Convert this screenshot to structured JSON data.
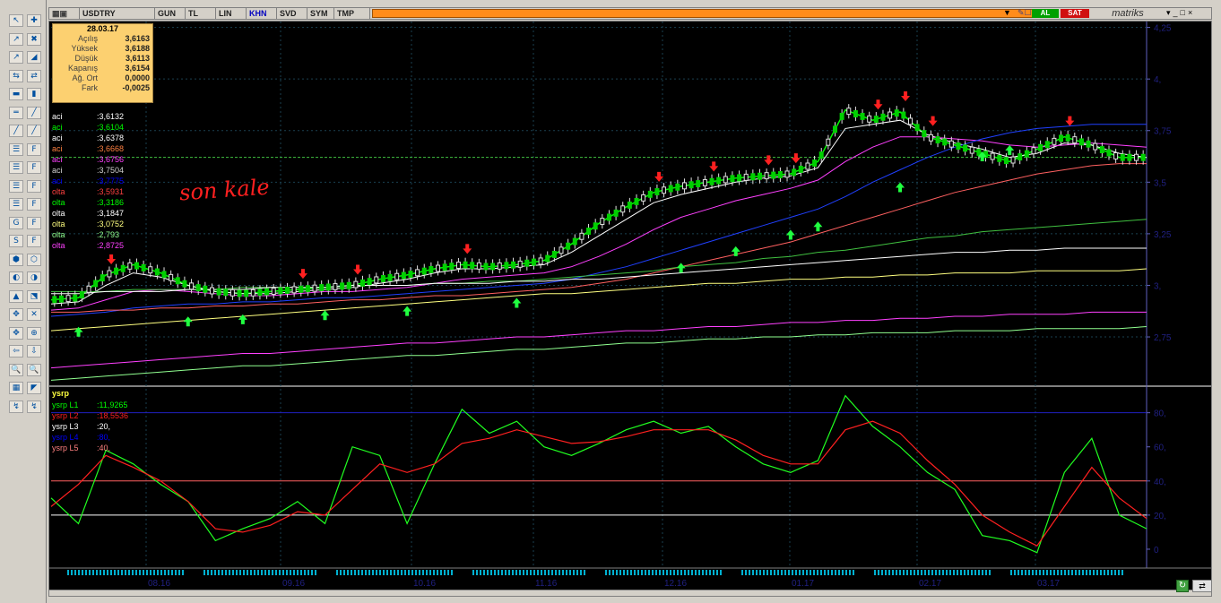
{
  "window": {
    "symbol": "USDTRY",
    "tabs": [
      "GUN",
      "TL",
      "LIN",
      "KHN",
      "SVD",
      "SYM",
      "TMP"
    ],
    "buy_label": "AL",
    "sell_label": "SAT",
    "brand": "matriks"
  },
  "infobox": {
    "date": "28.03.17",
    "rows": [
      {
        "k": "Açılış",
        "v": "3,6163"
      },
      {
        "k": "Yüksek",
        "v": "3,6188"
      },
      {
        "k": "Düşük",
        "v": "3,6113"
      },
      {
        "k": "Kapanış",
        "v": "3,6154"
      },
      {
        "k": "Ağ. Ort",
        "v": "0,0000"
      },
      {
        "k": "Fark",
        "v": "-0,0025"
      }
    ]
  },
  "indicators": [
    {
      "n": "aci",
      "v": ":3,6132",
      "c": "#ffffff"
    },
    {
      "n": "aci",
      "v": ":3,6104",
      "c": "#00ff00"
    },
    {
      "n": "aci",
      "v": ":3,6378",
      "c": "#ffffff"
    },
    {
      "n": "aci",
      "v": ":3,6668",
      "c": "#ff8040"
    },
    {
      "n": "aci",
      "v": ":3,6756",
      "c": "#ff40ff"
    },
    {
      "n": "aci",
      "v": ":3,7504",
      "c": "#d0d0d0"
    },
    {
      "n": "aci",
      "v": ":3,7775",
      "c": "#0000ff"
    },
    {
      "n": "olta",
      "v": ":3,5931",
      "c": "#ff4040"
    },
    {
      "n": "olta",
      "v": ":3,3186",
      "c": "#00ff00"
    },
    {
      "n": "olta",
      "v": ":3,1847",
      "c": "#ffffff"
    },
    {
      "n": "olta",
      "v": ":3,0752",
      "c": "#ffff80"
    },
    {
      "n": "olta",
      "v": ":2,793",
      "c": "#90ff90"
    },
    {
      "n": "olta",
      "v": ":2,8725",
      "c": "#ff40ff"
    }
  ],
  "annotation": "son kale",
  "oscillator": {
    "title": "ysrp",
    "lines": [
      {
        "n": "ysrp L1",
        "v": ":11,9265",
        "c": "#00ff00"
      },
      {
        "n": "ysrp L2",
        "v": ":18,5536",
        "c": "#ff2020"
      },
      {
        "n": "ysrp L3",
        "v": ":20,",
        "c": "#ffffff"
      },
      {
        "n": "ysrp L4",
        "v": ":80,",
        "c": "#0000ff"
      },
      {
        "n": "ysrp L5",
        "v": ":40,",
        "c": "#ff8080"
      }
    ]
  },
  "chart_data": [
    {
      "type": "line",
      "title": "USDTRY",
      "y_ticks": [
        "4,25",
        "4,",
        "3,75",
        "3,5",
        "3,25",
        "3,",
        "2,75"
      ],
      "ylim": [
        2.52,
        4.27
      ],
      "x_labels": [
        "08.16",
        "09.16",
        "10.16",
        "11.16",
        "12.16",
        "01.17",
        "02.17",
        "03.17"
      ],
      "series": [
        {
          "name": "close",
          "values": [
            2.93,
            2.94,
            3.05,
            3.1,
            3.06,
            3.0,
            2.97,
            2.96,
            2.97,
            2.98,
            2.99,
            3.0,
            3.03,
            3.05,
            3.08,
            3.1,
            3.09,
            3.1,
            3.12,
            3.2,
            3.3,
            3.38,
            3.45,
            3.48,
            3.5,
            3.52,
            3.53,
            3.54,
            3.6,
            3.85,
            3.8,
            3.84,
            3.72,
            3.68,
            3.64,
            3.6,
            3.66,
            3.72,
            3.68,
            3.62,
            3.62
          ]
        },
        {
          "name": "",
          "values": [
            2.91,
            2.92,
            3.0,
            3.06,
            3.04,
            3.0,
            2.97,
            2.96,
            2.96,
            2.97,
            2.98,
            2.99,
            3.01,
            3.03,
            3.06,
            3.08,
            3.08,
            3.09,
            3.1,
            3.16,
            3.24,
            3.32,
            3.4,
            3.44,
            3.47,
            3.5,
            3.52,
            3.53,
            3.57,
            3.76,
            3.78,
            3.8,
            3.73,
            3.69,
            3.66,
            3.62,
            3.64,
            3.69,
            3.68,
            3.64,
            3.62
          ]
        },
        {
          "name": "",
          "values": [
            2.88,
            2.89,
            2.93,
            2.97,
            2.98,
            2.97,
            2.96,
            2.95,
            2.95,
            2.96,
            2.97,
            2.97,
            2.98,
            2.99,
            3.01,
            3.03,
            3.04,
            3.05,
            3.06,
            3.09,
            3.14,
            3.2,
            3.27,
            3.33,
            3.37,
            3.41,
            3.44,
            3.47,
            3.51,
            3.6,
            3.67,
            3.72,
            3.72,
            3.71,
            3.7,
            3.68,
            3.67,
            3.68,
            3.69,
            3.68,
            3.67
          ]
        },
        {
          "name": "",
          "values": [
            2.85,
            2.86,
            2.87,
            2.89,
            2.9,
            2.91,
            2.91,
            2.92,
            2.92,
            2.93,
            2.94,
            2.94,
            2.95,
            2.96,
            2.97,
            2.98,
            2.99,
            3.0,
            3.01,
            3.03,
            3.06,
            3.09,
            3.13,
            3.17,
            3.21,
            3.25,
            3.29,
            3.33,
            3.37,
            3.43,
            3.5,
            3.56,
            3.62,
            3.67,
            3.71,
            3.74,
            3.76,
            3.77,
            3.78,
            3.78,
            3.78
          ]
        },
        {
          "name": "",
          "values": [
            2.87,
            2.87,
            2.88,
            2.88,
            2.89,
            2.89,
            2.9,
            2.9,
            2.91,
            2.91,
            2.92,
            2.93,
            2.93,
            2.94,
            2.95,
            2.95,
            2.96,
            2.97,
            2.98,
            2.99,
            3.01,
            3.03,
            3.06,
            3.09,
            3.12,
            3.15,
            3.18,
            3.21,
            3.25,
            3.29,
            3.33,
            3.37,
            3.41,
            3.45,
            3.48,
            3.51,
            3.54,
            3.56,
            3.58,
            3.59,
            3.59
          ]
        },
        {
          "name": "",
          "values": [
            2.97,
            2.97,
            2.97,
            2.98,
            2.98,
            2.98,
            2.98,
            2.99,
            2.99,
            2.99,
            2.99,
            3.0,
            3.0,
            3.0,
            3.01,
            3.01,
            3.02,
            3.02,
            3.03,
            3.04,
            3.05,
            3.06,
            3.07,
            3.09,
            3.1,
            3.11,
            3.13,
            3.14,
            3.16,
            3.17,
            3.19,
            3.21,
            3.23,
            3.24,
            3.26,
            3.27,
            3.28,
            3.29,
            3.3,
            3.31,
            3.32
          ]
        },
        {
          "name": "",
          "values": [
            2.96,
            2.96,
            2.97,
            2.97,
            2.97,
            2.98,
            2.98,
            2.98,
            2.99,
            2.99,
            2.99,
            3.0,
            3.0,
            3.0,
            3.01,
            3.01,
            3.01,
            3.02,
            3.02,
            3.03,
            3.03,
            3.04,
            3.05,
            3.06,
            3.07,
            3.08,
            3.09,
            3.1,
            3.11,
            3.12,
            3.13,
            3.14,
            3.15,
            3.16,
            3.16,
            3.17,
            3.17,
            3.18,
            3.18,
            3.18,
            3.18
          ]
        },
        {
          "name": "",
          "values": [
            2.78,
            2.79,
            2.8,
            2.81,
            2.82,
            2.83,
            2.84,
            2.85,
            2.86,
            2.87,
            2.88,
            2.89,
            2.9,
            2.91,
            2.92,
            2.93,
            2.94,
            2.95,
            2.96,
            2.96,
            2.97,
            2.98,
            2.99,
            3.0,
            3.01,
            3.01,
            3.02,
            3.03,
            3.03,
            3.04,
            3.04,
            3.05,
            3.05,
            3.06,
            3.06,
            3.06,
            3.07,
            3.07,
            3.07,
            3.07,
            3.08
          ]
        },
        {
          "name": "",
          "values": [
            2.6,
            2.61,
            2.62,
            2.63,
            2.64,
            2.65,
            2.66,
            2.67,
            2.67,
            2.68,
            2.69,
            2.7,
            2.71,
            2.72,
            2.72,
            2.73,
            2.74,
            2.75,
            2.75,
            2.76,
            2.77,
            2.78,
            2.78,
            2.79,
            2.8,
            2.8,
            2.81,
            2.82,
            2.82,
            2.83,
            2.83,
            2.84,
            2.84,
            2.85,
            2.85,
            2.86,
            2.86,
            2.86,
            2.87,
            2.87,
            2.87
          ]
        },
        {
          "name": "",
          "values": [
            2.54,
            2.55,
            2.56,
            2.57,
            2.58,
            2.59,
            2.6,
            2.61,
            2.61,
            2.62,
            2.63,
            2.64,
            2.65,
            2.66,
            2.66,
            2.67,
            2.68,
            2.69,
            2.69,
            2.7,
            2.71,
            2.72,
            2.72,
            2.73,
            2.74,
            2.74,
            2.75,
            2.75,
            2.76,
            2.76,
            2.77,
            2.77,
            2.77,
            2.78,
            2.78,
            2.78,
            2.79,
            2.79,
            2.79,
            2.79,
            2.8
          ]
        }
      ],
      "series_colors": [
        "#00ff00",
        "#ffffff",
        "#ff40ff",
        "#2040ff",
        "#ff6060",
        "#40c040",
        "#ffffff",
        "#ffff80",
        "#ff40ff",
        "#90ff90"
      ],
      "hline": 3.62,
      "buy_arrows": [
        1,
        5,
        7,
        10,
        13,
        17,
        23,
        25,
        27,
        28,
        31,
        34,
        35
      ],
      "sell_arrows": [
        2,
        9,
        11,
        15,
        22,
        24,
        26,
        27,
        30,
        31,
        32,
        37
      ]
    },
    {
      "type": "line",
      "title": "ysrp",
      "y_ticks": [
        "80,",
        "60,",
        "40,",
        "20,",
        "0"
      ],
      "ylim": [
        -10,
        94
      ],
      "hlines": [
        80,
        40,
        20
      ],
      "series": [
        {
          "name": "ysrp L1",
          "values": [
            30,
            15,
            58,
            50,
            38,
            28,
            5,
            12,
            18,
            28,
            15,
            60,
            55,
            15,
            50,
            82,
            68,
            75,
            60,
            55,
            62,
            70,
            75,
            68,
            72,
            60,
            50,
            45,
            52,
            90,
            72,
            60,
            45,
            35,
            8,
            5,
            -2,
            45,
            65,
            20,
            12
          ]
        },
        {
          "name": "ysrp L2",
          "values": [
            25,
            38,
            55,
            48,
            40,
            28,
            12,
            10,
            14,
            22,
            20,
            35,
            50,
            45,
            50,
            62,
            65,
            70,
            66,
            62,
            63,
            66,
            70,
            70,
            70,
            64,
            55,
            50,
            50,
            70,
            75,
            68,
            52,
            38,
            20,
            10,
            2,
            25,
            48,
            30,
            18
          ]
        }
      ]
    }
  ]
}
